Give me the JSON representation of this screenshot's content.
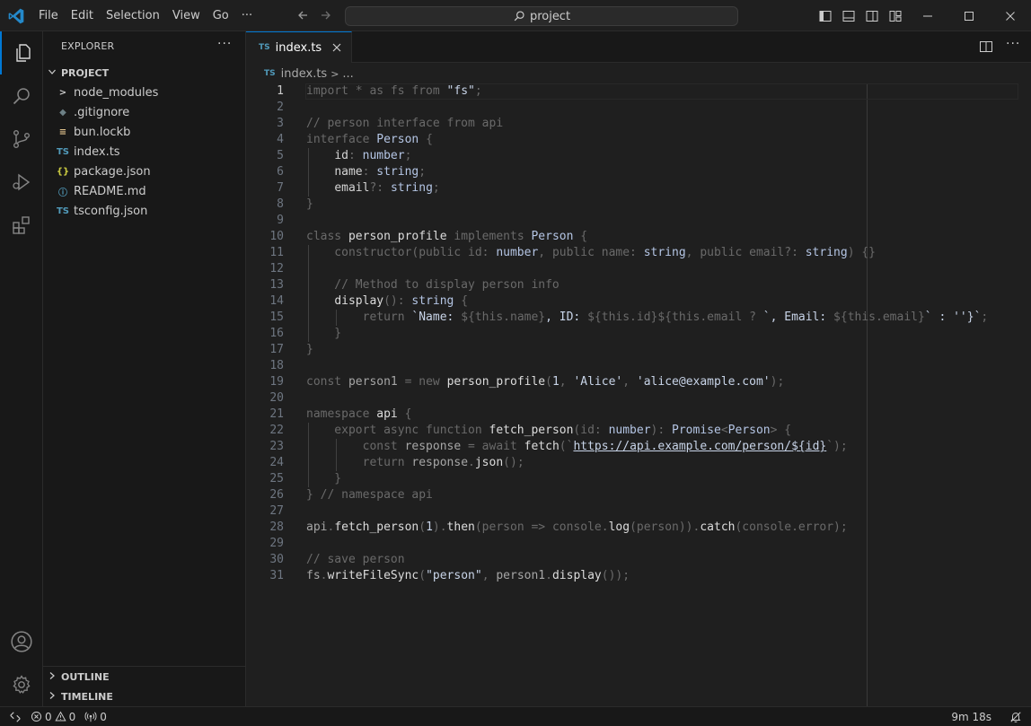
{
  "menubar": {
    "items": [
      "File",
      "Edit",
      "Selection",
      "View",
      "Go",
      "···"
    ]
  },
  "search": {
    "label": "project"
  },
  "sidebar": {
    "title": "EXPLORER",
    "more": "···",
    "project_label": "PROJECT",
    "files": [
      {
        "name": "node_modules",
        "icon": "chevron-right-icon",
        "glyph": ">",
        "color": "#cccccc"
      },
      {
        "name": ".gitignore",
        "icon": "gitignore-icon",
        "glyph": "◆",
        "color": "#6d8086"
      },
      {
        "name": "bun.lockb",
        "icon": "lock-file-icon",
        "glyph": "≡",
        "color": "#e3c58e"
      },
      {
        "name": "index.ts",
        "icon": "typescript-icon",
        "glyph": "TS",
        "color": "#519aba"
      },
      {
        "name": "package.json",
        "icon": "json-icon",
        "glyph": "{}",
        "color": "#cbcb41"
      },
      {
        "name": "README.md",
        "icon": "info-icon",
        "glyph": "ⓘ",
        "color": "#519aba"
      },
      {
        "name": "tsconfig.json",
        "icon": "tsconfig-icon",
        "glyph": "TS",
        "color": "#519aba"
      }
    ],
    "outline_label": "OUTLINE",
    "timeline_label": "TIMELINE"
  },
  "tabs": [
    {
      "label": "index.ts",
      "badge": "TS"
    }
  ],
  "breadcrumb": {
    "badge": "TS",
    "file": "index.ts",
    "sep": ">",
    "more": "..."
  },
  "editor": {
    "current_line": 1,
    "lines": [
      [
        [
          "import * as fs from ",
          "t-dim"
        ],
        [
          "\"fs\"",
          "t-str"
        ],
        [
          ";",
          "t-dim"
        ]
      ],
      [],
      [
        [
          "// person interface from api",
          "t-dim"
        ]
      ],
      [
        [
          "interface ",
          "t-dim"
        ],
        [
          "Person",
          "t-type"
        ],
        [
          " {",
          "t-dim"
        ]
      ],
      [
        [
          "    "
        ],
        [
          "id",
          "t-bright"
        ],
        [
          ": ",
          "t-dim"
        ],
        [
          "number",
          "t-type"
        ],
        [
          ";",
          "t-dim"
        ]
      ],
      [
        [
          "    "
        ],
        [
          "name",
          "t-bright"
        ],
        [
          ": ",
          "t-dim"
        ],
        [
          "string",
          "t-type"
        ],
        [
          ";",
          "t-dim"
        ]
      ],
      [
        [
          "    "
        ],
        [
          "email",
          "t-bright"
        ],
        [
          "?: ",
          "t-dim"
        ],
        [
          "string",
          "t-type"
        ],
        [
          ";",
          "t-dim"
        ]
      ],
      [
        [
          "}",
          "t-dim"
        ]
      ],
      [],
      [
        [
          "class ",
          "t-dim"
        ],
        [
          "person_profile",
          "t-fn"
        ],
        [
          " implements ",
          "t-dim"
        ],
        [
          "Person",
          "t-type"
        ],
        [
          " {",
          "t-dim"
        ]
      ],
      [
        [
          "    constructor(public id: ",
          "t-dim"
        ],
        [
          "number",
          "t-type"
        ],
        [
          ", public name: ",
          "t-dim"
        ],
        [
          "string",
          "t-type"
        ],
        [
          ", public email?: ",
          "t-dim"
        ],
        [
          "string",
          "t-type"
        ],
        [
          ") {}",
          "t-dim"
        ]
      ],
      [],
      [
        [
          "    // Method to display person info",
          "t-dim"
        ]
      ],
      [
        [
          "    "
        ],
        [
          "display",
          "t-fn"
        ],
        [
          "(): ",
          "t-dim"
        ],
        [
          "string",
          "t-type"
        ],
        [
          " {",
          "t-dim"
        ]
      ],
      [
        [
          "        return ",
          "t-dim"
        ],
        [
          "`Name: ",
          "t-str"
        ],
        [
          "${this.name}",
          "t-dim"
        ],
        [
          ", ID: ",
          "t-str"
        ],
        [
          "${this.id}${this.email ? ",
          "t-dim"
        ],
        [
          "`, Email: ",
          "t-str"
        ],
        [
          "${this.email}",
          "t-dim"
        ],
        [
          "` : ''}`",
          "t-str"
        ],
        [
          ";",
          "t-dim"
        ]
      ],
      [
        [
          "    }",
          "t-dim"
        ]
      ],
      [
        [
          "}",
          "t-dim"
        ]
      ],
      [],
      [
        [
          "const ",
          "t-dim"
        ],
        [
          "person1",
          "t-plain"
        ],
        [
          " = new ",
          "t-dim"
        ],
        [
          "person_profile",
          "t-fn"
        ],
        [
          "(",
          "t-dim"
        ],
        [
          "1",
          "t-str"
        ],
        [
          ", ",
          "t-dim"
        ],
        [
          "'Alice'",
          "t-str"
        ],
        [
          ", ",
          "t-dim"
        ],
        [
          "'alice@example.com'",
          "t-str"
        ],
        [
          ");",
          "t-dim"
        ]
      ],
      [],
      [
        [
          "namespace ",
          "t-dim"
        ],
        [
          "api",
          "t-fn"
        ],
        [
          " {",
          "t-dim"
        ]
      ],
      [
        [
          "    export async function ",
          "t-dim"
        ],
        [
          "fetch_person",
          "t-fn"
        ],
        [
          "(id: ",
          "t-dim"
        ],
        [
          "number",
          "t-type"
        ],
        [
          "): ",
          "t-dim"
        ],
        [
          "Promise",
          "t-type"
        ],
        [
          "<",
          "t-dim"
        ],
        [
          "Person",
          "t-type"
        ],
        [
          "> {",
          "t-dim"
        ]
      ],
      [
        [
          "        const ",
          "t-dim"
        ],
        [
          "response",
          "t-plain"
        ],
        [
          " = await ",
          "t-dim"
        ],
        [
          "fetch",
          "t-fn"
        ],
        [
          "(`",
          "t-dim"
        ],
        [
          "https://api.example.com/person/",
          "t-url"
        ],
        [
          "${id}",
          "t-url"
        ],
        [
          "`);",
          "t-dim"
        ]
      ],
      [
        [
          "        return ",
          "t-dim"
        ],
        [
          "response",
          "t-plain"
        ],
        [
          ".",
          "t-dim"
        ],
        [
          "json",
          "t-fn"
        ],
        [
          "();",
          "t-dim"
        ]
      ],
      [
        [
          "    }",
          "t-dim"
        ]
      ],
      [
        [
          "} // namespace api",
          "t-dim"
        ]
      ],
      [],
      [
        [
          "api",
          "t-plain"
        ],
        [
          ".",
          "t-dim"
        ],
        [
          "fetch_person",
          "t-fn"
        ],
        [
          "(",
          "t-dim"
        ],
        [
          "1",
          "t-str"
        ],
        [
          ").",
          "t-dim"
        ],
        [
          "then",
          "t-fn"
        ],
        [
          "(person => console.",
          "t-dim"
        ],
        [
          "log",
          "t-fn"
        ],
        [
          "(person)).",
          "t-dim"
        ],
        [
          "catch",
          "t-fn"
        ],
        [
          "(console.error);",
          "t-dim"
        ]
      ],
      [],
      [
        [
          "// save person",
          "t-dim"
        ]
      ],
      [
        [
          "fs",
          "t-plain"
        ],
        [
          ".",
          "t-dim"
        ],
        [
          "writeFileSync",
          "t-fn"
        ],
        [
          "(",
          "t-dim"
        ],
        [
          "\"person\"",
          "t-str"
        ],
        [
          ", ",
          "t-dim"
        ],
        [
          "person1",
          "t-plain"
        ],
        [
          ".",
          "t-dim"
        ],
        [
          "display",
          "t-fn"
        ],
        [
          "());",
          "t-dim"
        ]
      ]
    ]
  },
  "statusbar": {
    "errors": "0",
    "warnings": "0",
    "ports": "0",
    "time": "9m 18s"
  }
}
